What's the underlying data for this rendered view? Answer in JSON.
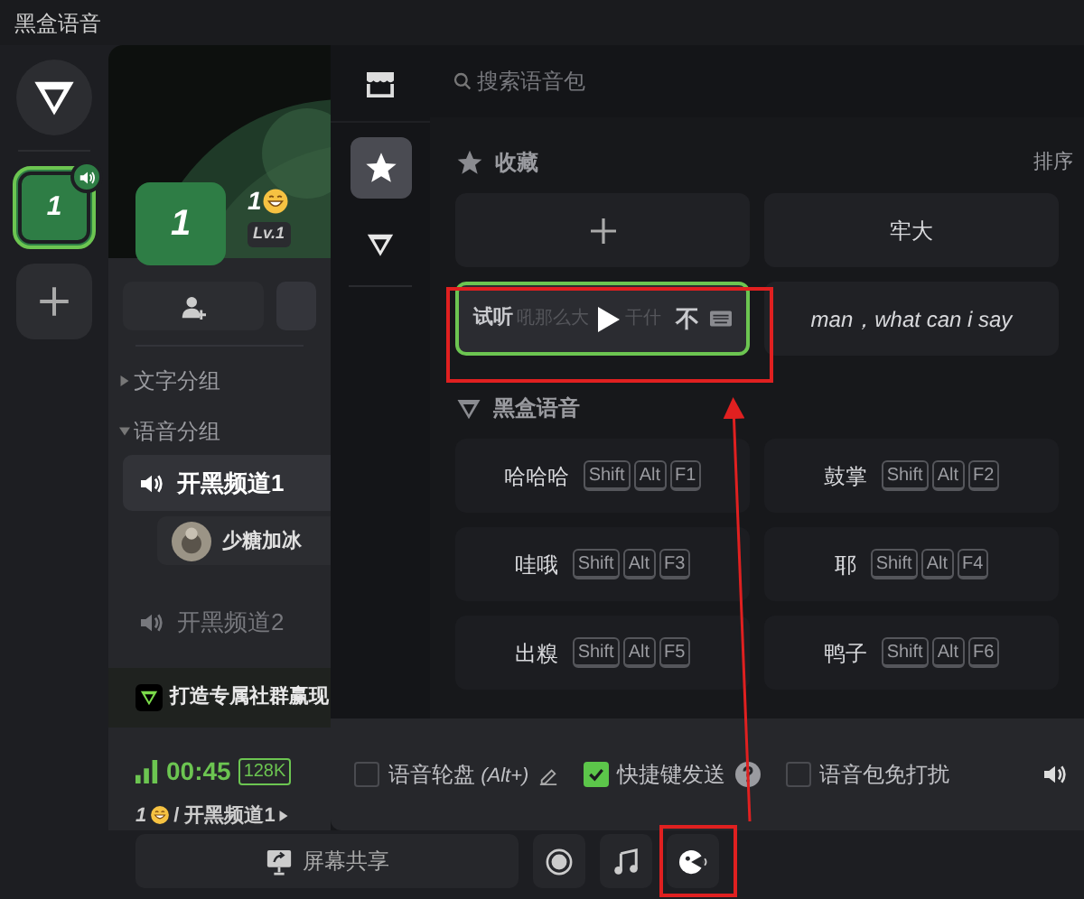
{
  "window": {
    "title": "黑盒语音"
  },
  "servers": [
    {
      "name": "1",
      "selected": true,
      "speaking": true
    }
  ],
  "profile": {
    "avatar": "1",
    "name": "1",
    "level": "Lv.1"
  },
  "groups": [
    {
      "name": "文字分组",
      "expanded": false
    },
    {
      "name": "语音分组",
      "expanded": true,
      "children": [
        {
          "name": "开黑频道1",
          "selected": true,
          "children": [
            {
              "name": "少糖加冰"
            }
          ]
        },
        {
          "name": "开黑频道2",
          "selected": false
        }
      ]
    }
  ],
  "promo": {
    "text": "打造专属社群赢现"
  },
  "status": {
    "time": "00:45",
    "bitrate": "128K",
    "user": "1",
    "channel": "/ 开黑频道1"
  },
  "toolbar": {
    "share": "屏幕共享",
    "tools": [
      {
        "kind": "record"
      },
      {
        "kind": "music"
      },
      {
        "kind": "soundpack"
      }
    ]
  },
  "pack_tabs": [
    {
      "kind": "star",
      "selected": true
    },
    {
      "kind": "logo",
      "selected": false
    }
  ],
  "search": {
    "placeholder": "搜索语音包"
  },
  "favorites": {
    "title": "收藏",
    "sort": "排序",
    "items": [
      {
        "kind": "add"
      },
      {
        "kind": "sound",
        "label": "牢大"
      },
      {
        "kind": "preview",
        "label": "试听",
        "text_before": "吼那么大",
        "text_after": "干什",
        "key": "不"
      },
      {
        "kind": "sound",
        "label": "man，what can i say",
        "italic": true
      }
    ]
  },
  "heihe": {
    "title": "黑盒语音",
    "items": [
      {
        "label": "哈哈哈",
        "keys": [
          "Shift",
          "Alt",
          "F1"
        ]
      },
      {
        "label": "鼓掌",
        "keys": [
          "Shift",
          "Alt",
          "F2"
        ]
      },
      {
        "label": "哇哦",
        "keys": [
          "Shift",
          "Alt",
          "F3"
        ]
      },
      {
        "label": "耶",
        "keys": [
          "Shift",
          "Alt",
          "F4"
        ]
      },
      {
        "label": "出糗",
        "keys": [
          "Shift",
          "Alt",
          "F5"
        ]
      },
      {
        "label": "鸭子",
        "keys": [
          "Shift",
          "Alt",
          "F6"
        ]
      }
    ]
  },
  "options": [
    {
      "kind": "edit",
      "label": "语音轮盘",
      "hint": "(Alt+)",
      "checked": false
    },
    {
      "kind": "help",
      "label": "快捷键发送",
      "checked": true
    },
    {
      "kind": "plain",
      "label": "语音包免打扰",
      "checked": false
    }
  ]
}
